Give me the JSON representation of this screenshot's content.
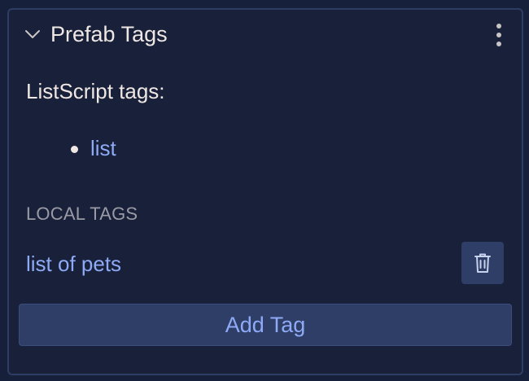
{
  "panel": {
    "title": "Prefab Tags",
    "collapse_icon": "chevron-down-icon",
    "menu_icon": "more-vertical-icon"
  },
  "inherited": {
    "label": "ListScript tags:",
    "tags": [
      "list"
    ]
  },
  "local": {
    "heading": "LOCAL TAGS",
    "tags": [
      {
        "name": "list of pets",
        "delete_icon": "trash-icon"
      }
    ]
  },
  "actions": {
    "add_tag_label": "Add Tag"
  },
  "colors": {
    "background": "#19213a",
    "border": "#2e3d63",
    "link": "#8eaaf6",
    "text": "#efe7e3",
    "muted": "#9a9aa6",
    "button": "#2e3e67"
  }
}
